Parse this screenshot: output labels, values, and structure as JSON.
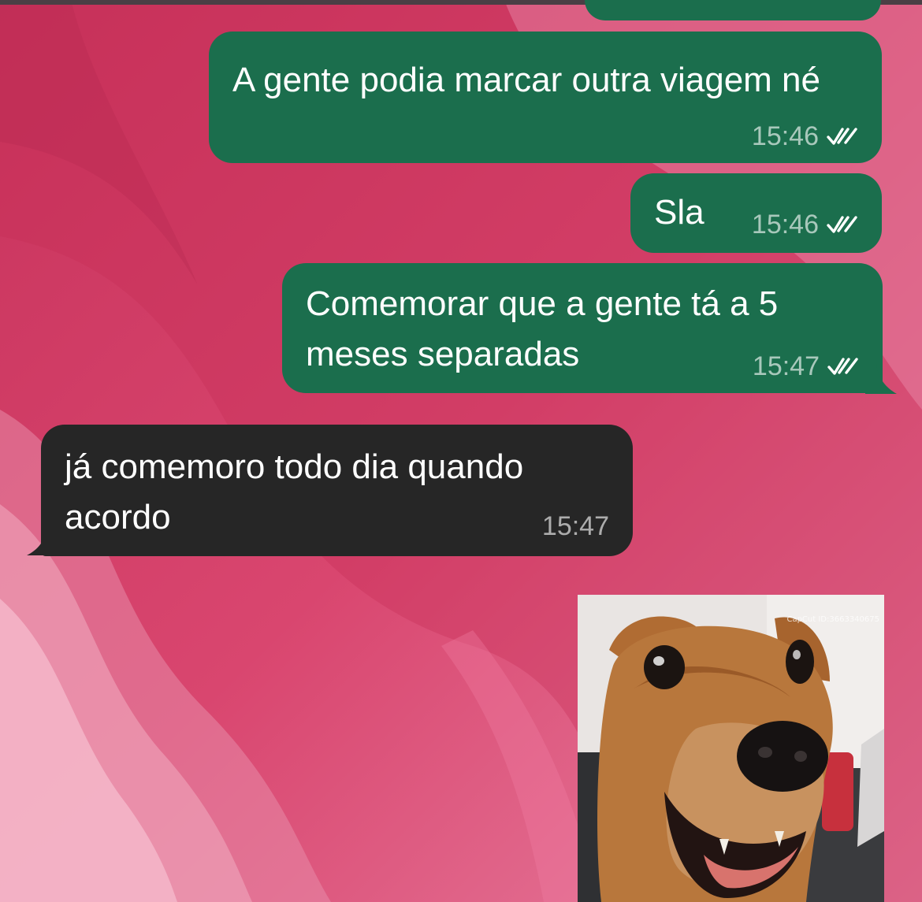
{
  "chat": {
    "messages": [
      {
        "id": "m1",
        "direction": "outgoing",
        "text": "A gente podia marcar outra viagem né",
        "time": "15:46",
        "status": "read"
      },
      {
        "id": "m2",
        "direction": "outgoing",
        "text": "Sla",
        "time": "15:46",
        "status": "read"
      },
      {
        "id": "m3",
        "direction": "outgoing",
        "text": "Comemorar que a gente tá a 5 meses separadas",
        "time": "15:47",
        "status": "read"
      },
      {
        "id": "m4",
        "direction": "incoming",
        "text": "já comemoro todo dia quando acordo",
        "time": "15:47"
      }
    ],
    "media": {
      "type": "image",
      "subject": "dog",
      "watermark": "CapCut  ID:3663340675"
    }
  },
  "colors": {
    "wallpaper": "#d2426a",
    "outgoing_bubble": "#1b6e4d",
    "incoming_bubble": "#262626",
    "timestamp": "#b9c9c0",
    "read_ticks": "#ffffff"
  },
  "icons": {
    "read_receipt": "double-check-icon"
  }
}
